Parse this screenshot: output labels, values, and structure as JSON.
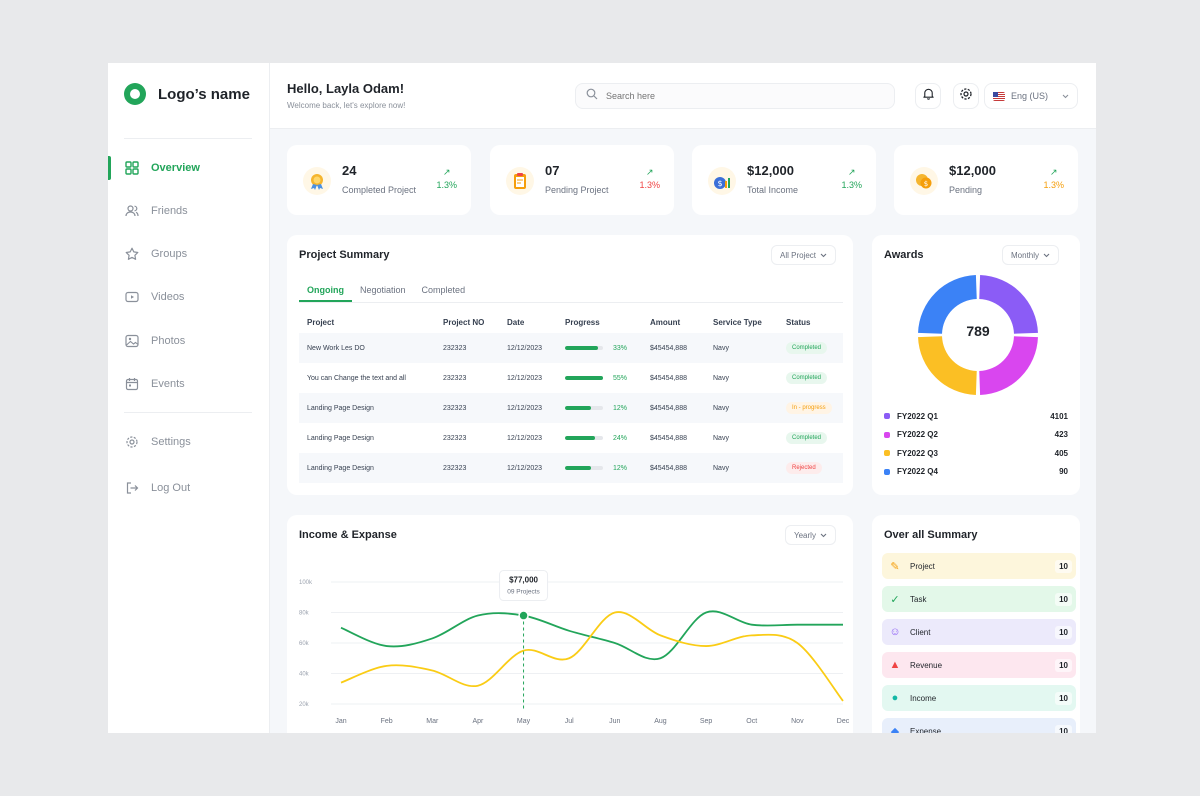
{
  "brand": {
    "logo_text": "Logo’s name",
    "accent": "#22a55a"
  },
  "sidebar": {
    "items": [
      {
        "label": "Overview",
        "icon": "grid-icon"
      },
      {
        "label": "Friends",
        "icon": "users-icon"
      },
      {
        "label": "Groups",
        "icon": "star-icon"
      },
      {
        "label": "Videos",
        "icon": "video-icon"
      },
      {
        "label": "Photos",
        "icon": "image-icon"
      },
      {
        "label": "Events",
        "icon": "calendar-icon"
      }
    ],
    "bottom": [
      {
        "label": "Settings",
        "icon": "gear-icon"
      },
      {
        "label": "Log Out",
        "icon": "logout-icon"
      }
    ]
  },
  "header": {
    "greeting": "Hello, Layla Odam!",
    "subtitle": "Welcome back, let's explore now!",
    "search_placeholder": "Search here",
    "language": "Eng (US)"
  },
  "stats": [
    {
      "value": "24",
      "label": "Completed Project",
      "trend": "1.3%",
      "trend_color": "#22a55a"
    },
    {
      "value": "07",
      "label": "Pending Project",
      "trend": "1.3%",
      "trend_color": "#ef4444"
    },
    {
      "value": "$12,000",
      "label": "Total Income",
      "trend": "1.3%",
      "trend_color": "#22a55a"
    },
    {
      "value": "$12,000",
      "label": "Pending",
      "trend": "1.3%",
      "trend_color": "#f59e0b"
    }
  ],
  "project_summary": {
    "title": "Project Summary",
    "filter": "All Project",
    "tabs": [
      "Ongoing",
      "Negotiation",
      "Completed"
    ],
    "columns": [
      "Project",
      "Project NO",
      "Date",
      "Progress",
      "Amount",
      "Service Type",
      "Status"
    ],
    "rows": [
      {
        "project": "New Work Les DO",
        "no": "232323",
        "date": "12/12/2023",
        "progress": 33,
        "progress_label": "33%",
        "amount": "$45454,888",
        "service": "Navy",
        "status": "Completed",
        "status_kind": "completed"
      },
      {
        "project": "You can Change the text and all",
        "no": "232323",
        "date": "12/12/2023",
        "progress": 55,
        "progress_label": "55%",
        "amount": "$45454,888",
        "service": "Navy",
        "status": "Completed",
        "status_kind": "completed"
      },
      {
        "project": "Landing Page Design",
        "no": "232323",
        "date": "12/12/2023",
        "progress": 12,
        "progress_label": "12%",
        "amount": "$45454,888",
        "service": "Navy",
        "status": "In - progress",
        "status_kind": "progress"
      },
      {
        "project": "Landing Page Design",
        "no": "232323",
        "date": "12/12/2023",
        "progress": 24,
        "progress_label": "24%",
        "amount": "$45454,888",
        "service": "Navy",
        "status": "Completed",
        "status_kind": "completed"
      },
      {
        "project": "Landing Page Design",
        "no": "232323",
        "date": "12/12/2023",
        "progress": 12,
        "progress_label": "12%",
        "amount": "$45454,888",
        "service": "Navy",
        "status": "Rejected",
        "status_kind": "rejected"
      }
    ]
  },
  "awards": {
    "title": "Awards",
    "filter": "Monthly",
    "total": "789",
    "items": [
      {
        "label": "FY2022 Q1",
        "value": 4101,
        "color": "#8b5cf6"
      },
      {
        "label": "FY2022 Q2",
        "value": 423,
        "color": "#d946ef"
      },
      {
        "label": "FY2022 Q3",
        "value": 405,
        "color": "#fbbf24"
      },
      {
        "label": "FY2022 Q4",
        "value": 90,
        "color": "#3b82f6"
      }
    ]
  },
  "income_expense": {
    "title": "Income & Expanse",
    "filter": "Yearly",
    "tooltip": {
      "value": "$77,000",
      "label": "09 Projects",
      "month": "May"
    }
  },
  "chart_data": {
    "type": "line",
    "x": [
      "Jan",
      "Feb",
      "Mar",
      "Apr",
      "May",
      "Jul",
      "Jun",
      "Aug",
      "Sep",
      "Oct",
      "Nov",
      "Dec"
    ],
    "yticks": [
      "100k",
      "80k",
      "60k",
      "40k",
      "20k"
    ],
    "ylim": [
      20,
      100
    ],
    "series": [
      {
        "color": "#22a55a",
        "values": [
          70,
          58,
          63,
          78,
          78,
          68,
          60,
          50,
          80,
          72,
          72,
          72
        ]
      },
      {
        "color": "#facc15",
        "values": [
          34,
          45,
          42,
          32,
          55,
          50,
          80,
          65,
          58,
          65,
          60,
          22
        ]
      }
    ]
  },
  "summary": {
    "title": "Over all Summary",
    "items": [
      {
        "label": "Project",
        "value": "10",
        "bg": "#fdf6dc",
        "icon": "clipboard-icon"
      },
      {
        "label": "Task",
        "value": "10",
        "bg": "#e3f8e9",
        "icon": "task-icon"
      },
      {
        "label": "Client",
        "value": "10",
        "bg": "#eceafb",
        "icon": "client-icon"
      },
      {
        "label": "Revenue",
        "value": "10",
        "bg": "#fde7ef",
        "icon": "revenue-icon"
      },
      {
        "label": "Income",
        "value": "10",
        "bg": "#e3f8f1",
        "icon": "income-icon"
      },
      {
        "label": "Expense",
        "value": "10",
        "bg": "#e8effb",
        "icon": "expense-icon"
      }
    ]
  }
}
